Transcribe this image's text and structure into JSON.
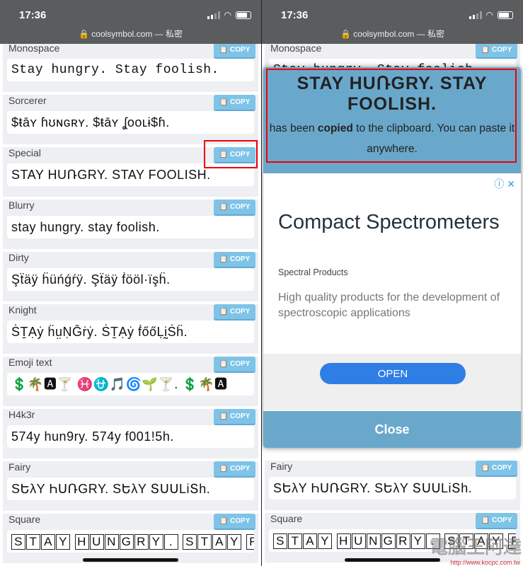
{
  "status": {
    "time": "17:36",
    "url": "coolsymbol.com — 私密"
  },
  "copy_label": "COPY",
  "left_cards": [
    {
      "label": "Monospace",
      "text": "Stay hungry. Stay foolish.",
      "mono": true
    },
    {
      "label": "Sorcerer",
      "text": "$ŧāʏ ɦʊɴɢʀʏ. $ŧāʏ ʆooʟɨ$ɦ."
    },
    {
      "label": "Special",
      "text": "STAY HUՌGRY. STAY FOOLISH."
    },
    {
      "label": "Blurry",
      "text": "stay hungry. stay foolish."
    },
    {
      "label": "Dirty",
      "text": "Şẗäÿ ḧüńǵŕÿ. Şẗäÿ ḟööl·ïşḧ."
    },
    {
      "label": "Knight",
      "text": "ṠṮẠẏ ḧṳṆḠṙẏ. ṠṮẠẏ ḟőőḶḭṠḧ."
    },
    {
      "label": "Emoji text",
      "text": "💲🌴🅰🍸 ♓⛎🎵🌀🌱🍸. 💲🌴🅰"
    },
    {
      "label": "H4k3r",
      "text": "574y hun9ry. 574y f001!5h."
    },
    {
      "label": "Fairy",
      "text": "SԵλY ҺՍՌGRY. SԵλY ՏՍՍLiՏh."
    },
    {
      "label": "Square",
      "text": "STAY HUNGRY. STAY F",
      "square": true
    }
  ],
  "modal": {
    "copied_text": "STAY HUՌGRY. STAY FOOLISH.",
    "msg_pre": "has been ",
    "msg_bold": "copied",
    "msg_post": " to the clipboard. You can paste it anywhere.",
    "close_label": "Close"
  },
  "ad": {
    "title": "Compact Spectrometers",
    "advertiser": "Spectral Products",
    "description": "High quality products for the development of spectroscopic applications",
    "cta": "OPEN",
    "info_icon": "info-icon",
    "close_icon": "close-icon"
  },
  "watermark": {
    "logo": "電腦王阿達",
    "url": "http://www.kocpc.com.tw"
  },
  "colors": {
    "copy_button": "#7ec3e8",
    "modal_blue": "#6aa8cb",
    "open_button": "#2f7ee6",
    "highlight": "#e00000"
  }
}
